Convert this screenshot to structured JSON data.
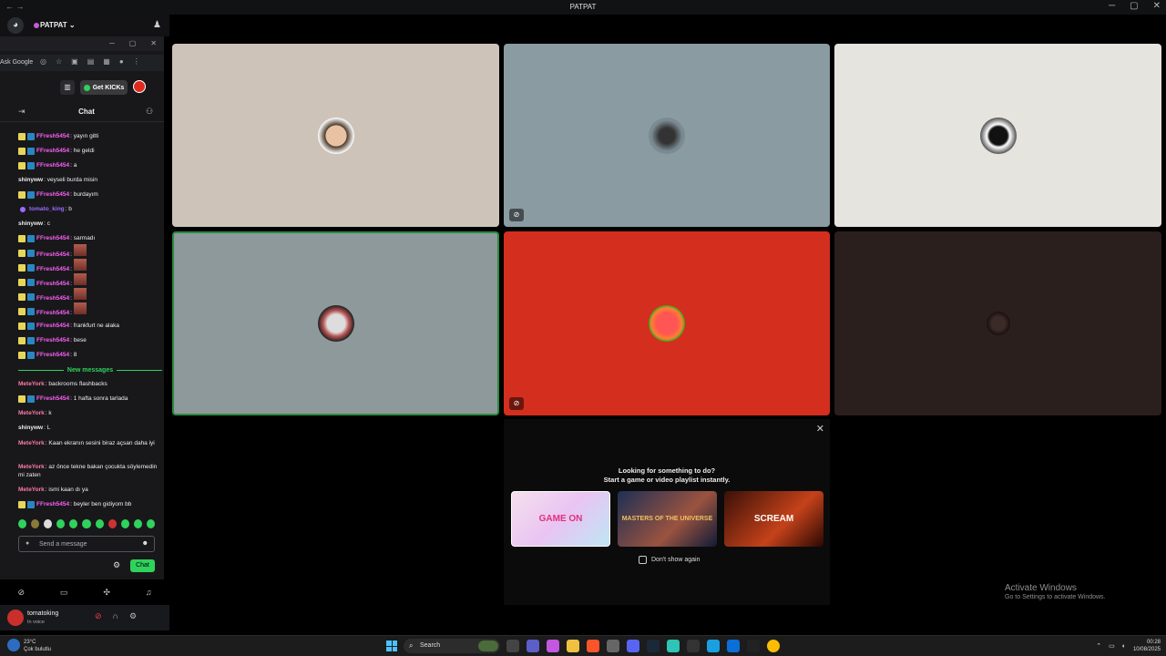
{
  "window": {
    "title": "PATPAT",
    "nav_back": "←",
    "nav_fwd": "→"
  },
  "server": {
    "name": "PATPAT ⌄"
  },
  "popout": {
    "url_text": "Ask Google",
    "get_kicks": "Get KICKs",
    "chat_title": "Chat",
    "new_messages": "New messages",
    "input_placeholder": "Send a message",
    "chat_button": "Chat"
  },
  "chat": {
    "messages": [
      {
        "badges": 2,
        "user": "FFresh5454",
        "color": "#ff5ff5",
        "text": ": yayın gitti"
      },
      {
        "badges": 2,
        "user": "FFresh5454",
        "color": "#ff5ff5",
        "text": ": he geldi"
      },
      {
        "badges": 2,
        "user": "FFresh5454",
        "color": "#ff5ff5",
        "text": ": a"
      },
      {
        "badges": 0,
        "user": "shinyww",
        "color": "#efeff1",
        "text": ": veyseli burda misin"
      },
      {
        "badges": 2,
        "user": "FFresh5454",
        "color": "#ff5ff5",
        "text": ": burdayım"
      },
      {
        "badges": 0,
        "user": "tomato_king",
        "color": "#9b6bff",
        "text": ": b",
        "purple": true
      },
      {
        "badges": 0,
        "user": "shinyww",
        "color": "#efeff1",
        "text": ": c"
      },
      {
        "badges": 2,
        "user": "FFresh5454",
        "color": "#ff5ff5",
        "text": ": sarmadı"
      },
      {
        "badges": 2,
        "user": "FFresh5454",
        "color": "#ff5ff5",
        "text": ":",
        "emote": true
      },
      {
        "badges": 2,
        "user": "FFresh5454",
        "color": "#ff5ff5",
        "text": ":",
        "emote": true
      },
      {
        "badges": 2,
        "user": "FFresh5454",
        "color": "#ff5ff5",
        "text": ":",
        "emote": true
      },
      {
        "badges": 2,
        "user": "FFresh5454",
        "color": "#ff5ff5",
        "text": ":",
        "emote": true
      },
      {
        "badges": 2,
        "user": "FFresh5454",
        "color": "#ff5ff5",
        "text": ":",
        "emote": true
      },
      {
        "badges": 2,
        "user": "FFresh5454",
        "color": "#ff5ff5",
        "text": ": frankfurt ne alaka"
      },
      {
        "badges": 2,
        "user": "FFresh5454",
        "color": "#ff5ff5",
        "text": ": bese"
      },
      {
        "badges": 2,
        "user": "FFresh5454",
        "color": "#ff5ff5",
        "text": ": 8"
      }
    ],
    "new_messages": [
      {
        "badges": 0,
        "user": "MeteYork",
        "color": "#ff7aa8",
        "text": ": backrooms flashbacks"
      },
      {
        "badges": 2,
        "user": "FFresh5454",
        "color": "#ff5ff5",
        "text": ": 1 hafta sonra tarlada"
      },
      {
        "badges": 0,
        "user": "MeteYork",
        "color": "#ff7aa8",
        "text": ": k"
      },
      {
        "badges": 0,
        "user": "shinyww",
        "color": "#efeff1",
        "text": ": L"
      },
      {
        "badges": 0,
        "user": "MeteYork",
        "color": "#ff7aa8",
        "text": ": Kaan ekranın sesini biraz açsan daha iyi",
        "two": true
      },
      {
        "badges": 0,
        "user": "MeteYork",
        "color": "#ff7aa8",
        "text": ": az önce tekne bakan çocukta söylemedin mi zaten",
        "two": true
      },
      {
        "badges": 0,
        "user": "MeteYork",
        "color": "#ff7aa8",
        "text": ": ismi kaan dı ya"
      },
      {
        "badges": 2,
        "user": "FFresh5454",
        "color": "#ff5ff5",
        "text": ": beyler ben gidiyom bb"
      }
    ]
  },
  "user": {
    "name": "tomatoking",
    "status": "In voice"
  },
  "activity": {
    "heading_1": "Looking for something to do?",
    "heading_2": "Start a game or video playlist instantly.",
    "cards": [
      "GAME ON",
      "MASTERS OF THE UNIVERSE",
      "SCREAM"
    ],
    "dont_show": "Don't show again"
  },
  "watermark": {
    "line1": "Activate Windows",
    "line2": "Go to Settings to activate Windows."
  },
  "taskbar": {
    "weather_temp": "23°C",
    "weather_desc": "Çok bulutlu",
    "search": "Search",
    "time": "00:28",
    "date": "10/08/2025"
  },
  "colors": {
    "accent_green": "#2fd35b",
    "tile_red": "#d42e1f",
    "speaking_border": "#2b8a3e"
  }
}
